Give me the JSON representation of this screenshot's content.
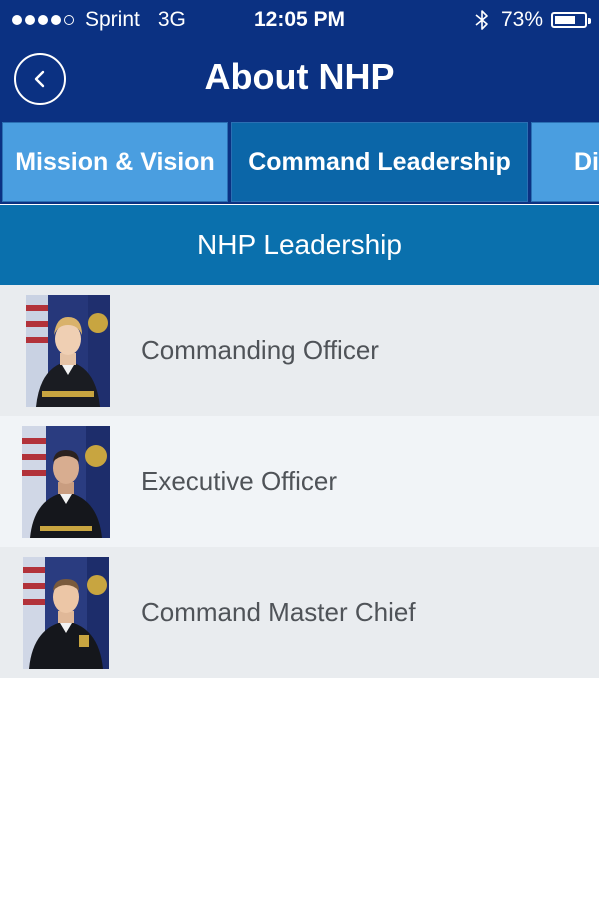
{
  "status_bar": {
    "carrier": "Sprint",
    "network": "3G",
    "time": "12:05 PM",
    "battery_text": "73%",
    "battery_level": 0.73,
    "signal_bars": 4,
    "signal_total": 5,
    "icons": [
      "signal-dots-icon",
      "bluetooth-icon",
      "battery-icon"
    ]
  },
  "nav": {
    "title": "About NHP",
    "back_icon": "chevron-left-icon"
  },
  "tabs": [
    {
      "label": "Mission & Vision",
      "active": false
    },
    {
      "label": "Command Leadership",
      "active": true
    },
    {
      "label": "Di",
      "active": false
    }
  ],
  "section": {
    "title": "NHP Leadership"
  },
  "leaders": [
    {
      "label": "Commanding Officer",
      "photo": "commanding-officer-photo"
    },
    {
      "label": "Executive Officer",
      "photo": "executive-officer-photo"
    },
    {
      "label": "Command Master Chief",
      "photo": "command-master-chief-photo"
    }
  ],
  "colors": {
    "header_bg": "#0b3182",
    "tab_bg": "#4a9ee0",
    "tab_active_bg": "#0b66a8",
    "section_bg": "#0a70ad",
    "row_bg": "#e9ecef",
    "row_alt_bg": "#f1f4f7",
    "row_text": "#4f5358"
  }
}
